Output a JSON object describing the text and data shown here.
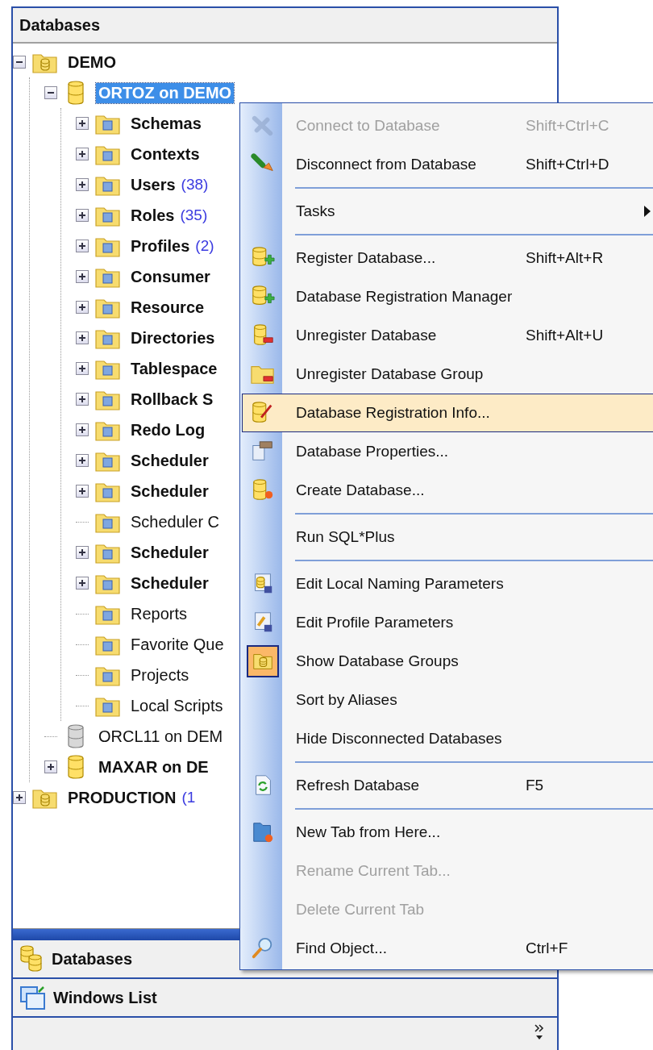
{
  "panel": {
    "title": "Databases"
  },
  "tree": [
    {
      "kind": "group",
      "label": "DEMO",
      "bold": true,
      "expanded": true,
      "selected": false,
      "children": [
        {
          "kind": "database",
          "label": "ORTOZ on DEMO",
          "bold": true,
          "connected": true,
          "expanded": true,
          "selected": true,
          "children": [
            {
              "kind": "folder",
              "label": "Schemas",
              "bold": true,
              "expanded": false,
              "selected": false
            },
            {
              "kind": "folder",
              "label": "Contexts",
              "bold": true,
              "expanded": false,
              "selected": false
            },
            {
              "kind": "folder",
              "label": "Users",
              "count": "(38)",
              "bold": true,
              "expanded": false,
              "selected": false
            },
            {
              "kind": "folder",
              "label": "Roles",
              "count": "(35)",
              "bold": true,
              "expanded": false,
              "selected": false
            },
            {
              "kind": "folder",
              "label": "Profiles",
              "count": "(2)",
              "bold": true,
              "expanded": false,
              "selected": false
            },
            {
              "kind": "folder",
              "label": "Consumer",
              "bold": true,
              "expanded": false,
              "selected": false
            },
            {
              "kind": "folder",
              "label": "Resource",
              "bold": true,
              "expanded": false,
              "selected": false
            },
            {
              "kind": "folder",
              "label": "Directories",
              "bold": true,
              "expanded": false,
              "selected": false
            },
            {
              "kind": "folder",
              "label": "Tablespace",
              "bold": true,
              "expanded": false,
              "selected": false
            },
            {
              "kind": "folder",
              "label": "Rollback S",
              "bold": true,
              "expanded": false,
              "selected": false
            },
            {
              "kind": "folder",
              "label": "Redo Log",
              "bold": true,
              "expanded": false,
              "selected": false
            },
            {
              "kind": "folder",
              "label": "Scheduler",
              "bold": true,
              "expanded": false,
              "selected": false
            },
            {
              "kind": "folder",
              "label": "Scheduler",
              "bold": true,
              "expanded": false,
              "selected": false
            },
            {
              "kind": "folder",
              "label": "Scheduler C",
              "bold": false,
              "selected": false
            },
            {
              "kind": "folder",
              "label": "Scheduler",
              "bold": true,
              "expanded": false,
              "selected": false
            },
            {
              "kind": "folder",
              "label": "Scheduler",
              "bold": true,
              "expanded": false,
              "selected": false
            },
            {
              "kind": "folder",
              "label": "Reports",
              "bold": false,
              "selected": false
            },
            {
              "kind": "folder",
              "label": "Favorite Que",
              "bold": false,
              "selected": false
            },
            {
              "kind": "folder",
              "label": "Projects",
              "bold": false,
              "selected": false
            },
            {
              "kind": "folder",
              "label": "Local Scripts",
              "bold": false,
              "selected": false
            }
          ]
        },
        {
          "kind": "database",
          "label": "ORCL11 on DEM",
          "bold": false,
          "connected": false,
          "selected": false
        },
        {
          "kind": "database",
          "label": "MAXAR on DE",
          "bold": true,
          "connected": true,
          "expanded": false,
          "selected": false
        }
      ]
    },
    {
      "kind": "group",
      "label": "PRODUCTION",
      "count": "(1",
      "bold": true,
      "expanded": false,
      "selected": false
    }
  ],
  "nav_panes": [
    {
      "label": "Databases"
    },
    {
      "label": "Windows List"
    }
  ],
  "context_menu": [
    {
      "kind": "item",
      "label": "Connect to Database",
      "shortcut": "Shift+Ctrl+C",
      "disabled": true,
      "selected": false
    },
    {
      "kind": "item",
      "label": "Disconnect from Database",
      "shortcut": "Shift+Ctrl+D",
      "disabled": false,
      "selected": false
    },
    {
      "kind": "separator"
    },
    {
      "kind": "item",
      "label": "Tasks",
      "submenu": true,
      "disabled": false,
      "selected": false
    },
    {
      "kind": "separator"
    },
    {
      "kind": "item",
      "label": "Register Database...",
      "shortcut": "Shift+Alt+R",
      "disabled": false,
      "selected": false
    },
    {
      "kind": "item",
      "label": "Database Registration Manager",
      "disabled": false,
      "selected": false
    },
    {
      "kind": "item",
      "label": "Unregister Database",
      "shortcut": "Shift+Alt+U",
      "disabled": false,
      "selected": false
    },
    {
      "kind": "item",
      "label": "Unregister Database Group",
      "disabled": false,
      "selected": false
    },
    {
      "kind": "item",
      "label": "Database Registration Info...",
      "disabled": false,
      "selected": true
    },
    {
      "kind": "item",
      "label": "Database Properties...",
      "disabled": false,
      "selected": false
    },
    {
      "kind": "item",
      "label": "Create Database...",
      "disabled": false,
      "selected": false
    },
    {
      "kind": "separator"
    },
    {
      "kind": "item",
      "label": "Run SQL*Plus",
      "disabled": false,
      "selected": false
    },
    {
      "kind": "separator"
    },
    {
      "kind": "item",
      "label": "Edit Local Naming Parameters",
      "disabled": false,
      "selected": false
    },
    {
      "kind": "item",
      "label": "Edit Profile Parameters",
      "disabled": false,
      "selected": false
    },
    {
      "kind": "item",
      "label": "Show Database Groups",
      "disabled": false,
      "selected": false,
      "checked": true
    },
    {
      "kind": "item",
      "label": "Sort by Aliases",
      "disabled": false,
      "selected": false
    },
    {
      "kind": "item",
      "label": "Hide Disconnected Databases",
      "disabled": false,
      "selected": false
    },
    {
      "kind": "separator"
    },
    {
      "kind": "item",
      "label": "Refresh Database",
      "shortcut": "F5",
      "disabled": false,
      "selected": false
    },
    {
      "kind": "separator"
    },
    {
      "kind": "item",
      "label": "New Tab from Here...",
      "disabled": false,
      "selected": false
    },
    {
      "kind": "item",
      "label": "Rename Current Tab...",
      "disabled": true,
      "selected": false
    },
    {
      "kind": "item",
      "label": "Delete Current Tab",
      "disabled": true,
      "selected": false
    },
    {
      "kind": "item",
      "label": "Find Object...",
      "shortcut": "Ctrl+F",
      "disabled": false,
      "selected": false
    }
  ]
}
